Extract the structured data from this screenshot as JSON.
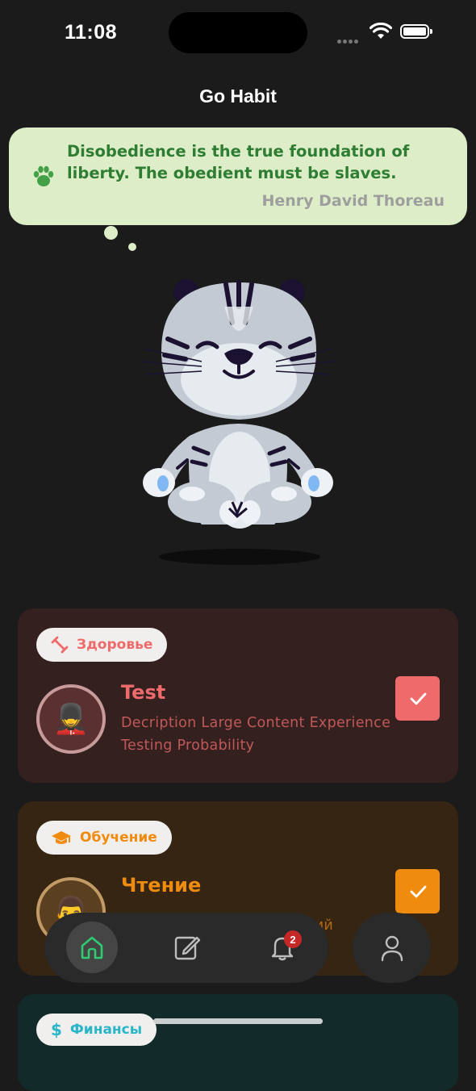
{
  "status_bar": {
    "time": "11:08"
  },
  "app": {
    "title": "Go Habit"
  },
  "quote": {
    "text": "Disobedience is the true foundation of liberty. The obedient must be slaves.",
    "author": "Henry David Thoreau"
  },
  "habits": [
    {
      "category": "Здоровье",
      "category_icon": "dumbbell-icon",
      "title": "Test",
      "description": "Decription Large Content Experience Testing Probability",
      "avatar_emoji": "💂",
      "checked": true,
      "accent": "#ef6b6b"
    },
    {
      "category": "Обучение",
      "category_icon": "graduation-cap-icon",
      "title": "Чтение",
      "description": "ний",
      "avatar_emoji": "👨",
      "checked": true,
      "accent": "#ef8c10"
    },
    {
      "category": "Финансы",
      "category_icon": "dollar-icon",
      "accent": "#29b6c8"
    }
  ],
  "nav": {
    "items": [
      "home-icon",
      "edit-icon",
      "bell-icon"
    ],
    "notification_count": "2",
    "active": "home",
    "profile_icon": "person-icon"
  },
  "colors": {
    "background": "#1b1b1b",
    "quote_bg": "#dcedc8",
    "quote_text": "#2e7d32",
    "health_card": "#352020",
    "study_card": "#352512",
    "finance_card": "#132a2a",
    "home_active": "#2ecc71"
  }
}
